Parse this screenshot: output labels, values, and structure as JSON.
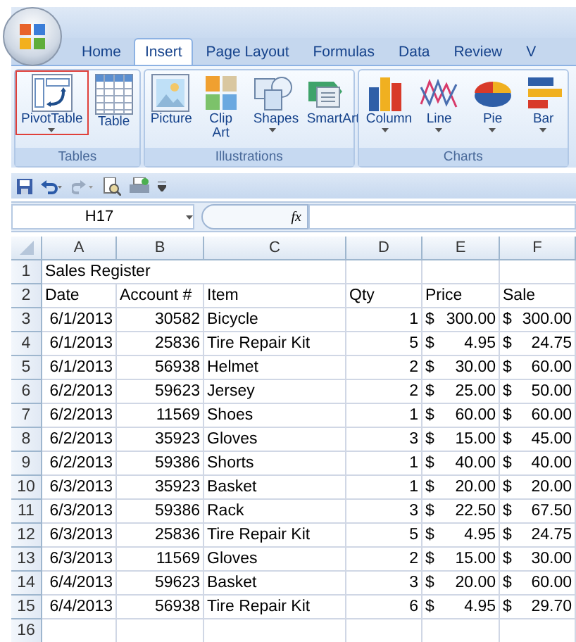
{
  "tabs": [
    {
      "label": "Home",
      "selected": false
    },
    {
      "label": "Insert",
      "selected": true
    },
    {
      "label": "Page Layout",
      "selected": false
    },
    {
      "label": "Formulas",
      "selected": false
    },
    {
      "label": "Data",
      "selected": false
    },
    {
      "label": "Review",
      "selected": false
    },
    {
      "label": "V",
      "selected": false
    }
  ],
  "ribbon_groups": [
    {
      "label": "Tables",
      "buttons": [
        {
          "kind": "pivot",
          "label": "PivotTable",
          "dropdown": true,
          "highlighted": true
        },
        {
          "kind": "table",
          "label": "Table",
          "dropdown": false,
          "highlighted": false
        }
      ]
    },
    {
      "label": "Illustrations",
      "buttons": [
        {
          "kind": "picture",
          "label": "Picture",
          "dropdown": false,
          "highlighted": false
        },
        {
          "kind": "clipart",
          "label": "Clip Art",
          "dropdown": false,
          "highlighted": false
        },
        {
          "kind": "shapes",
          "label": "Shapes",
          "dropdown": true,
          "highlighted": false
        },
        {
          "kind": "smartart",
          "label": "SmartArt",
          "dropdown": false,
          "highlighted": false
        }
      ]
    },
    {
      "label": "Charts",
      "buttons": [
        {
          "kind": "column",
          "label": "Column",
          "dropdown": true,
          "highlighted": false
        },
        {
          "kind": "line",
          "label": "Line",
          "dropdown": true,
          "highlighted": false
        },
        {
          "kind": "pie",
          "label": "Pie",
          "dropdown": true,
          "highlighted": false
        },
        {
          "kind": "bar",
          "label": "Bar",
          "dropdown": true,
          "highlighted": false
        }
      ]
    }
  ],
  "name_box": "H17",
  "formula_label": "fx",
  "columns": [
    "A",
    "B",
    "C",
    "D",
    "E",
    "F"
  ],
  "title_row": {
    "number": "1",
    "text": "Sales Register"
  },
  "header_row": {
    "number": "2",
    "cells": [
      "Date",
      "Account #",
      "Item",
      "Qty",
      "Price",
      "Sale"
    ]
  },
  "rows": [
    {
      "number": "3",
      "date": "6/1/2013",
      "account": "30582",
      "item": "Bicycle",
      "qty": "1",
      "price": {
        "symbol": "$",
        "amount": "300.00"
      },
      "sale": {
        "symbol": "$",
        "amount": "300.00"
      }
    },
    {
      "number": "4",
      "date": "6/1/2013",
      "account": "25836",
      "item": "Tire Repair Kit",
      "qty": "5",
      "price": {
        "symbol": "$",
        "amount": "4.95"
      },
      "sale": {
        "symbol": "$",
        "amount": "24.75"
      }
    },
    {
      "number": "5",
      "date": "6/1/2013",
      "account": "56938",
      "item": "Helmet",
      "qty": "2",
      "price": {
        "symbol": "$",
        "amount": "30.00"
      },
      "sale": {
        "symbol": "$",
        "amount": "60.00"
      }
    },
    {
      "number": "6",
      "date": "6/2/2013",
      "account": "59623",
      "item": "Jersey",
      "qty": "2",
      "price": {
        "symbol": "$",
        "amount": "25.00"
      },
      "sale": {
        "symbol": "$",
        "amount": "50.00"
      }
    },
    {
      "number": "7",
      "date": "6/2/2013",
      "account": "11569",
      "item": "Shoes",
      "qty": "1",
      "price": {
        "symbol": "$",
        "amount": "60.00"
      },
      "sale": {
        "symbol": "$",
        "amount": "60.00"
      }
    },
    {
      "number": "8",
      "date": "6/2/2013",
      "account": "35923",
      "item": "Gloves",
      "qty": "3",
      "price": {
        "symbol": "$",
        "amount": "15.00"
      },
      "sale": {
        "symbol": "$",
        "amount": "45.00"
      }
    },
    {
      "number": "9",
      "date": "6/2/2013",
      "account": "59386",
      "item": "Shorts",
      "qty": "1",
      "price": {
        "symbol": "$",
        "amount": "40.00"
      },
      "sale": {
        "symbol": "$",
        "amount": "40.00"
      }
    },
    {
      "number": "10",
      "date": "6/3/2013",
      "account": "35923",
      "item": "Basket",
      "qty": "1",
      "price": {
        "symbol": "$",
        "amount": "20.00"
      },
      "sale": {
        "symbol": "$",
        "amount": "20.00"
      }
    },
    {
      "number": "11",
      "date": "6/3/2013",
      "account": "59386",
      "item": "Rack",
      "qty": "3",
      "price": {
        "symbol": "$",
        "amount": "22.50"
      },
      "sale": {
        "symbol": "$",
        "amount": "67.50"
      }
    },
    {
      "number": "12",
      "date": "6/3/2013",
      "account": "25836",
      "item": "Tire Repair Kit",
      "qty": "5",
      "price": {
        "symbol": "$",
        "amount": "4.95"
      },
      "sale": {
        "symbol": "$",
        "amount": "24.75"
      }
    },
    {
      "number": "13",
      "date": "6/3/2013",
      "account": "11569",
      "item": "Gloves",
      "qty": "2",
      "price": {
        "symbol": "$",
        "amount": "15.00"
      },
      "sale": {
        "symbol": "$",
        "amount": "30.00"
      }
    },
    {
      "number": "14",
      "date": "6/4/2013",
      "account": "59623",
      "item": "Basket",
      "qty": "3",
      "price": {
        "symbol": "$",
        "amount": "20.00"
      },
      "sale": {
        "symbol": "$",
        "amount": "60.00"
      }
    },
    {
      "number": "15",
      "date": "6/4/2013",
      "account": "56938",
      "item": "Tire Repair Kit",
      "qty": "6",
      "price": {
        "symbol": "$",
        "amount": "4.95"
      },
      "sale": {
        "symbol": "$",
        "amount": "29.70"
      }
    }
  ],
  "empty_row": {
    "number": "16"
  }
}
